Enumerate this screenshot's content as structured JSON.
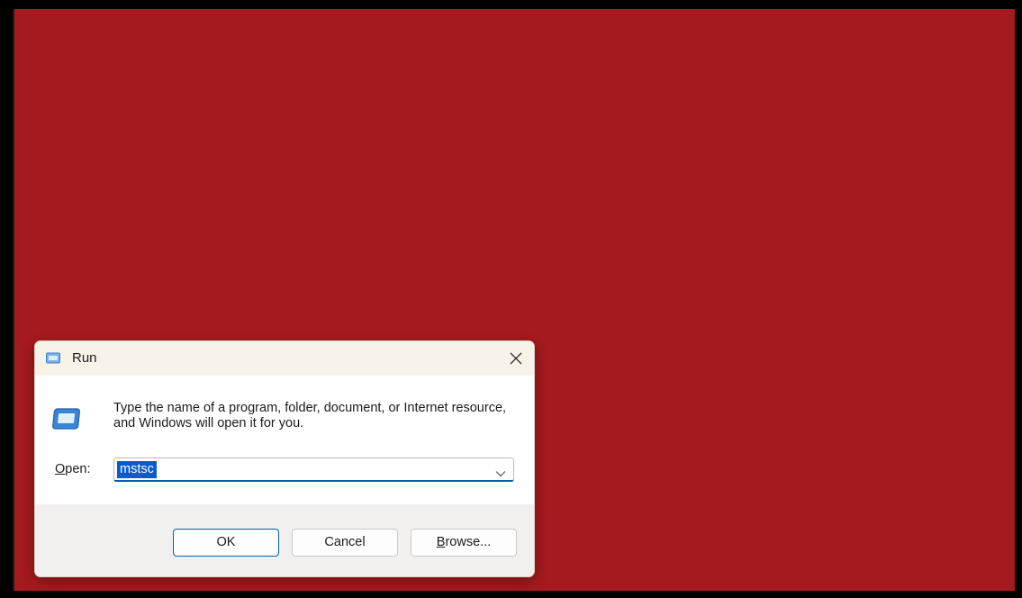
{
  "desktop": {
    "background_color": "#a51a1e"
  },
  "dialog": {
    "title": "Run",
    "title_icon": "run-icon",
    "close_icon": "close-icon",
    "app_icon": "run-program-icon",
    "message": "Type the name of a program, folder, document, or Internet resource, and Windows will open it for you.",
    "open_label_underlined": "O",
    "open_label_rest": "pen:",
    "input_value": "mstsc",
    "dropdown_icon": "chevron-down-icon",
    "buttons": {
      "ok_label": "OK",
      "cancel_label": "Cancel",
      "browse_label_underlined": "B",
      "browse_label_rest": "rowse..."
    },
    "accent_color": "#005fb8"
  }
}
